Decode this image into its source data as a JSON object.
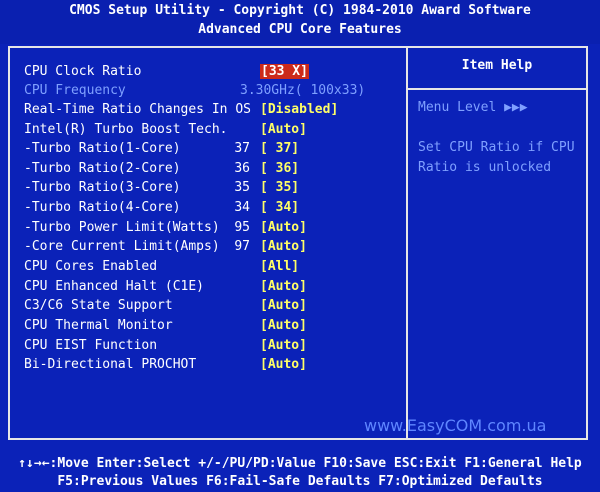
{
  "header": {
    "title": "CMOS Setup Utility - Copyright (C) 1984-2010 Award Software",
    "subtitle": "Advanced CPU Core Features"
  },
  "settings": [
    {
      "label": "CPU Clock Ratio",
      "number": "",
      "value": "[33 X]"
    },
    {
      "label": "CPU Frequency",
      "number": "",
      "value": "3.30GHz( 100x33)"
    },
    {
      "label": "Real-Time Ratio Changes In OS",
      "number": "",
      "value": "[Disabled]"
    },
    {
      "label": "Intel(R) Turbo Boost Tech.",
      "number": "",
      "value": "[Auto]"
    },
    {
      "label": "-Turbo Ratio(1-Core)",
      "number": "37",
      "value": "[  37]"
    },
    {
      "label": "-Turbo Ratio(2-Core)",
      "number": "36",
      "value": "[  36]"
    },
    {
      "label": "-Turbo Ratio(3-Core)",
      "number": "35",
      "value": "[  35]"
    },
    {
      "label": "-Turbo Ratio(4-Core)",
      "number": "34",
      "value": "[  34]"
    },
    {
      "label": "-Turbo Power Limit(Watts)",
      "number": "95",
      "value": "[Auto]"
    },
    {
      "label": "-Core Current Limit(Amps)",
      "number": "97",
      "value": "[Auto]"
    },
    {
      "label": "CPU Cores Enabled",
      "number": "",
      "value": "[All]"
    },
    {
      "label": "CPU Enhanced Halt (C1E)",
      "number": "",
      "value": "[Auto]"
    },
    {
      "label": "C3/C6 State Support",
      "number": "",
      "value": "[Auto]"
    },
    {
      "label": "CPU Thermal Monitor",
      "number": "",
      "value": "[Auto]"
    },
    {
      "label": "CPU EIST Function",
      "number": "",
      "value": "[Auto]"
    },
    {
      "label": "Bi-Directional PROCHOT",
      "number": "",
      "value": "[Auto]"
    }
  ],
  "help": {
    "title": "Item Help",
    "menu_level": "Menu Level   ▶▶▶",
    "text": "Set CPU Ratio if CPU Ratio is unlocked"
  },
  "watermark": "www.EasyCOM.com.ua",
  "footer": {
    "line1": "↑↓→←:Move  Enter:Select  +/-/PU/PD:Value  F10:Save  ESC:Exit  F1:General Help",
    "line2": "F5:Previous Values  F6:Fail-Safe Defaults  F7:Optimized Defaults"
  }
}
